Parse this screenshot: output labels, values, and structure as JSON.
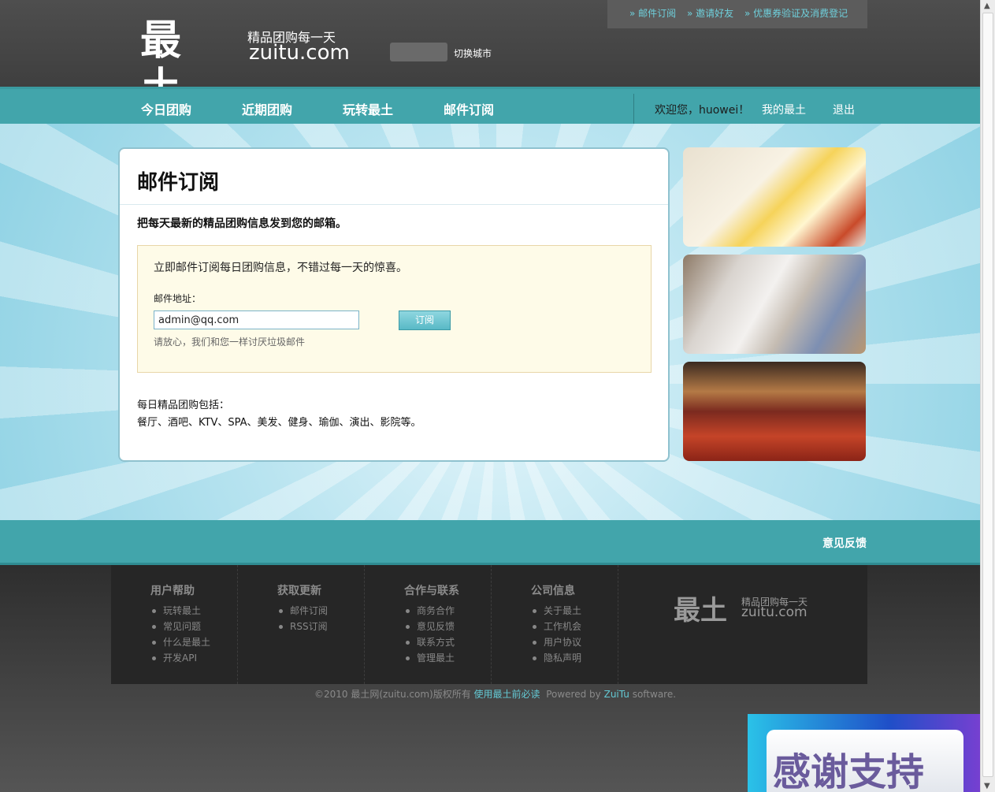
{
  "header": {
    "top_links": [
      "邮件订阅",
      "邀请好友",
      "优惠券验证及消费登记"
    ],
    "logo_zh": "最土",
    "logo_slogan": "精品团购每一天",
    "logo_en": "zuitu.com",
    "city_switch": "切换城市"
  },
  "nav": {
    "items": [
      "今日团购",
      "近期团购",
      "玩转最土",
      "邮件订阅"
    ],
    "welcome": "欢迎您，huowei！",
    "my_account": "我的最土",
    "logout": "退出"
  },
  "card": {
    "title": "邮件订阅",
    "subtitle": "把每天最新的精品团购信息发到您的邮箱。",
    "intro": "立即邮件订阅每日团购信息，不错过每一天的惊喜。",
    "email_label": "邮件地址：",
    "email_value": "admin@qq.com",
    "subscribe_button": "订阅",
    "note": "请放心，我们和您一样讨厌垃圾邮件",
    "includes_title": "每日精品团购包括：",
    "includes_list": "餐厅、酒吧、KTV、SPA、美发、健身、瑜伽、演出、影院等。"
  },
  "footer_bar": {
    "feedback": "意见反馈"
  },
  "footer": {
    "columns": [
      {
        "title": "用户帮助",
        "items": [
          "玩转最土",
          "常见问题",
          "什么是最土",
          "开发API"
        ]
      },
      {
        "title": "获取更新",
        "items": [
          "邮件订阅",
          "RSS订阅"
        ]
      },
      {
        "title": "合作与联系",
        "items": [
          "商务合作",
          "意见反馈",
          "联系方式",
          "管理最土"
        ]
      },
      {
        "title": "公司信息",
        "items": [
          "关于最土",
          "工作机会",
          "用户协议",
          "隐私声明"
        ]
      }
    ],
    "logo_zh": "最土",
    "logo_slogan": "精品团购每一天",
    "logo_en": "zuitu.com",
    "copyright": "©2010 最土网(zuitu.com)版权所有",
    "must_read": "使用最土前必读",
    "powered_prefix": "Powered by",
    "powered_brand": "ZuiTu",
    "powered_suffix": "software."
  },
  "banner": {
    "text": "感谢支持"
  },
  "colors": {
    "accent": "#42a5ab",
    "header_bg": "#474747",
    "link": "#6fd0dc"
  }
}
